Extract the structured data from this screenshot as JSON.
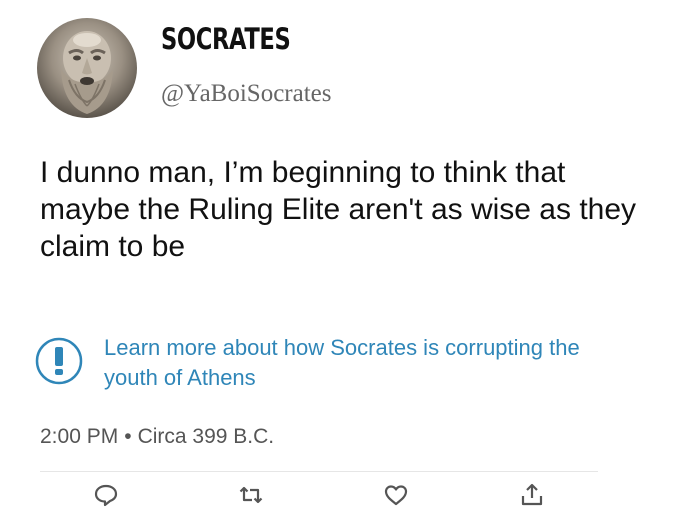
{
  "author": {
    "display_name": "SOCRATES",
    "handle": "@YaBoiSocrates",
    "avatar_icon": "socrates-bust-avatar"
  },
  "tweet": {
    "text": "I dunno man, I’m beginning to think that maybe the Ruling Elite aren't as wise as they claim to be"
  },
  "notice": {
    "icon": "exclamation-circle-icon",
    "text": "Learn more about how Socrates is corrupting the youth of Athens",
    "color": "#2f86b8"
  },
  "meta": {
    "time": "2:00 PM",
    "separator": "•",
    "date": "Circa 399 B.C."
  },
  "actions": [
    {
      "icon": "reply-icon"
    },
    {
      "icon": "retweet-icon"
    },
    {
      "icon": "like-icon"
    },
    {
      "icon": "share-icon"
    }
  ]
}
